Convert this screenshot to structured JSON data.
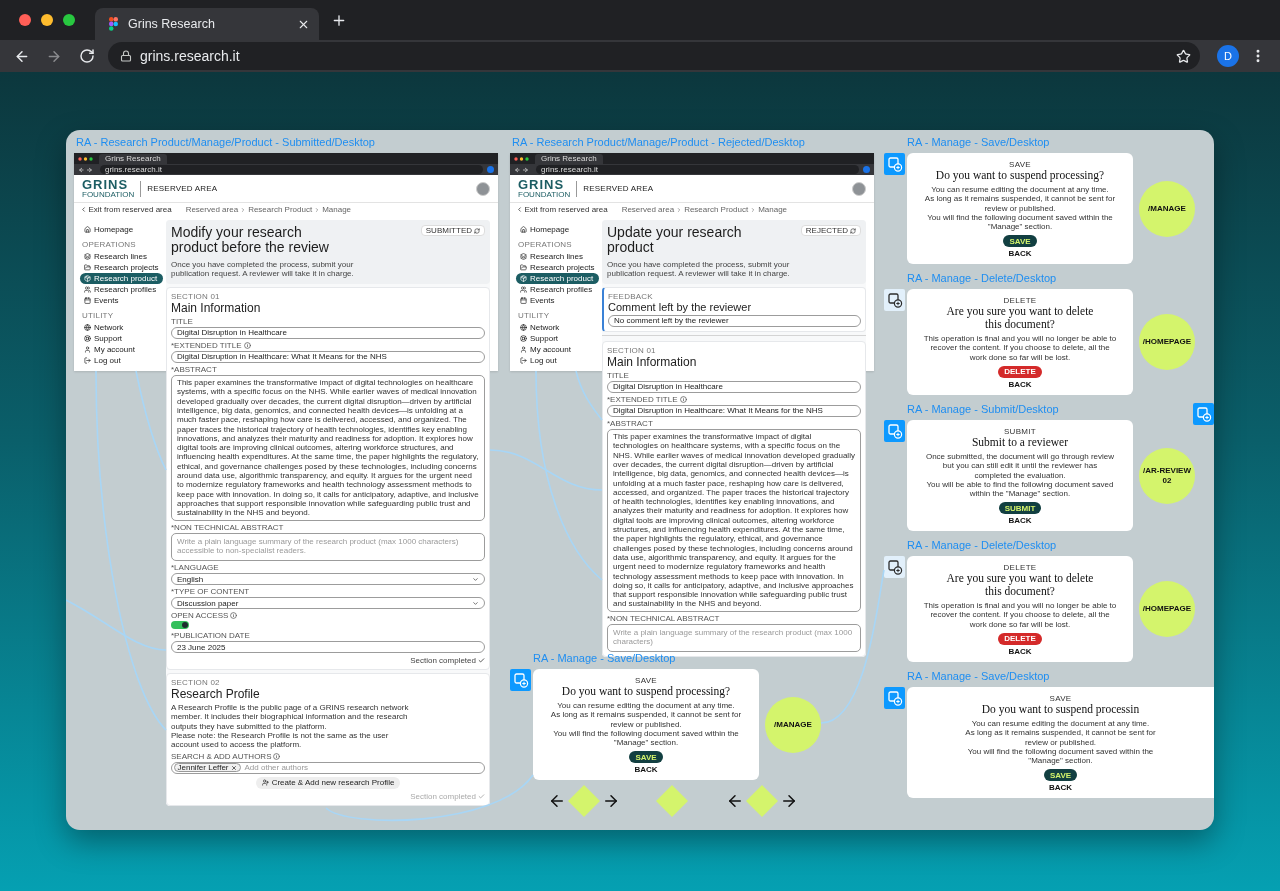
{
  "browser": {
    "tab_title": "Grins Research",
    "url": "grins.research.it",
    "avatar": "D"
  },
  "canvas": {
    "dialogs": [
      {
        "frame_label": "RA - Manage - Save/Desktop",
        "kind": "save",
        "flow_icon_active": true,
        "eyebrow": "SAVE",
        "heading": "Do you want to suspend processing?",
        "body": "You can resume editing the document at any time.\nAs long as it remains suspended, it cannot be sent for\nreview or published.\nYou will find the following document saved within the\n\"Manage\" section.",
        "button": "SAVE",
        "back": "BACK",
        "route": "/MANAGE"
      },
      {
        "frame_label": "RA - Manage - Delete/Desktop",
        "kind": "delete",
        "flow_icon_active": false,
        "eyebrow": "DELETE",
        "heading": "Are you sure you want to delete\nthis document?",
        "body": "This operation is final and you will no longer be able to\nrecover the content. If you choose to delete, all the\nwork done so far will be lost.",
        "button": "DELETE",
        "back": "BACK",
        "route": "/HOMEPAGE"
      },
      {
        "frame_label": "RA - Manage - Submit/Desktop",
        "kind": "submit",
        "flow_icon_active": true,
        "eyebrow": "SUBMIT",
        "heading": "Submit to a reviewer",
        "body": "Once submitted, the document will go through review\nbut you can still edit it until the reviewer has\ncompleted the evaluation.\nYou will be able to find the following document saved\nwithin the \"Manage\" section.",
        "button": "SUBMIT",
        "back": "BACK",
        "route": "/AR-REVIEW 02"
      },
      {
        "frame_label": "RA - Manage - Save/Desktop",
        "kind": "save",
        "flow_icon_active": true,
        "eyebrow": "SAVE",
        "heading": "Do you want to suspend processing?",
        "body": "You can resume editing the document at any time.\nAs long as it remains suspended, it cannot be sent for\nreview or published.\nYou will find the following document saved within the\n\"Manage\" section.",
        "button": "SAVE",
        "back": "BACK",
        "route": "/MANAGE"
      },
      {
        "frame_label": "RA - Manage - Delete/Desktop",
        "kind": "delete",
        "flow_icon_active": false,
        "eyebrow": "DELETE",
        "heading": "Are you sure you want to delete\nthis document?",
        "body": "This operation is final and you will no longer be able to\nrecover the content. If you choose to delete, all the\nwork done so far will be lost.",
        "button": "DELETE",
        "back": "BACK",
        "route": "/HOMEPAGE"
      },
      {
        "frame_label": "RA - Manage - Save/Desktop",
        "kind": "save",
        "flow_icon_active": true,
        "eyebrow": "SAVE",
        "heading": "Do you want to suspend processin",
        "body": "You can resume editing the document at any time.\nAs long as it remains suspended, it cannot be sent for\nreview or published.\nYou will find the following document saved within the\n\"Manage\" section.",
        "button": "SAVE",
        "back": "BACK"
      }
    ],
    "pages": [
      {
        "frame_label": "RA - Research Product/Manage/Product - Submitted/Desktop",
        "browser_tab": "Grins Research",
        "browser_url": "grins.research.it",
        "logo": "GRINS",
        "logo_tagline": "FOUNDATION",
        "area": "RESERVED AREA",
        "exit_link": "Exit from reserved area",
        "breadcrumb": [
          "Reserved area",
          "Research Product",
          "Manage"
        ],
        "sidebar": {
          "home": {
            "label": "Homepage",
            "selected": false
          },
          "groups": [
            {
              "title": "OPERATIONS",
              "items": [
                {
                  "label": "Research lines",
                  "selected": false
                },
                {
                  "label": "Research projects",
                  "selected": false
                },
                {
                  "label": "Research product",
                  "selected": true
                },
                {
                  "label": "Research profiles",
                  "selected": false
                },
                {
                  "label": "Events",
                  "selected": false
                }
              ]
            },
            {
              "title": "UTILITY",
              "items": [
                {
                  "label": "Network",
                  "selected": false
                },
                {
                  "label": "Support",
                  "selected": false
                },
                {
                  "label": "My account",
                  "selected": false
                },
                {
                  "label": "Log out",
                  "selected": false
                }
              ]
            }
          ]
        },
        "status": "SUBMITTED",
        "heading": "Modify your research\nproduct before the review",
        "intro": "Once you have completed the process, submit your\npublication request. A reviewer will take it in charge.",
        "sections": [
          {
            "kind": "form",
            "eyebrow": "SECTION 01",
            "title": "Main Information",
            "fields": [
              {
                "kind": "text",
                "label": "TITLE",
                "info": false,
                "value": "Digital Disruption in Healthcare"
              },
              {
                "kind": "text",
                "label": "*EXTENDED TITLE",
                "info": true,
                "value": "Digital Disruption in Healthcare: What It Means for the NHS"
              },
              {
                "kind": "textarea",
                "label": "*ABSTRACT",
                "info": false,
                "value": "This paper examines the transformative impact of digital technologies on healthcare systems, with a specific focus on the NHS. While earlier waves of medical innovation developed gradually over decades, the current digital disruption—driven by artificial intelligence, big data, genomics, and connected health devices—is unfolding at a much faster pace, reshaping how care is delivered, accessed, and organized. The paper traces the historical trajectory of health technologies, identifies key enabling innovations, and analyzes their maturity and readiness for adoption. It explores how digital tools are improving clinical outcomes, altering workforce structures, and influencing health expenditures. At the same time, the paper highlights the regulatory, ethical, and governance challenges posed by these technologies, including concerns around data use, algorithmic transparency, and equity. It argues for the urgent need to modernize regulatory frameworks and health technology assessment methods to keep pace with innovation. In doing so, it calls for anticipatory, adaptive, and inclusive approaches that support responsible innovation while safeguarding public trust and sustainability in the NHS and beyond."
              },
              {
                "kind": "textarea",
                "label": "*NON TECHNICAL ABSTRACT",
                "info": false,
                "placeholder": "Write a plain language summary of the research product (max 1000 characters)\naccessible to non-specialist readers."
              },
              {
                "kind": "select",
                "label": "*LANGUAGE",
                "info": false,
                "value": "English"
              },
              {
                "kind": "select",
                "label": "*TYPE OF CONTENT",
                "info": false,
                "value": "Discussion paper"
              },
              {
                "kind": "toggle",
                "label": "OPEN ACCESS",
                "info": true,
                "on": true
              },
              {
                "kind": "text",
                "label": "*PUBLICATION DATE",
                "info": false,
                "value": "23 June 2025"
              }
            ],
            "completion": {
              "label": "Section completed",
              "done": true
            }
          },
          {
            "kind": "form",
            "eyebrow": "SECTION 02",
            "title": "Research Profile",
            "description": "A Research Profile is the public page of a GRINS research network\nmember. It includes their biographical information and the research\noutputs they have submitted to the platform.\nPlease note: the Research Profile is not the same as the user\naccount used to access the platform.",
            "fields": [
              {
                "kind": "chips",
                "label": "SEARCH & ADD AUTHORS",
                "info": true,
                "chips": [
                  "Jennifer Leffer"
                ],
                "placeholder": "Add other authors"
              }
            ],
            "action": "Create & Add new research Profile",
            "completion": {
              "label": "Section completed",
              "done": false
            }
          }
        ]
      },
      {
        "frame_label": "RA - Research Product/Manage/Product - Rejected/Desktop",
        "browser_tab": "Grins Research",
        "browser_url": "grins.research.it",
        "logo": "GRINS",
        "logo_tagline": "FOUNDATION",
        "area": "RESERVED AREA",
        "exit_link": "Exit from reserved area",
        "breadcrumb": [
          "Reserved area",
          "Research Product",
          "Manage"
        ],
        "sidebar": {
          "home": {
            "label": "Homepage",
            "selected": false
          },
          "groups": [
            {
              "title": "OPERATIONS",
              "items": [
                {
                  "label": "Research lines",
                  "selected": false
                },
                {
                  "label": "Research projects",
                  "selected": false
                },
                {
                  "label": "Research product",
                  "selected": true
                },
                {
                  "label": "Research profiles",
                  "selected": false
                },
                {
                  "label": "Events",
                  "selected": false
                }
              ]
            },
            {
              "title": "UTILITY",
              "items": [
                {
                  "label": "Network",
                  "selected": false
                },
                {
                  "label": "Support",
                  "selected": false
                },
                {
                  "label": "My account",
                  "selected": false
                },
                {
                  "label": "Log out",
                  "selected": false
                }
              ]
            }
          ]
        },
        "status": "REJECTED",
        "heading": "Update your research\nproduct",
        "intro": "Once you have completed the process, submit your\npublication request. A reviewer will take it in charge.",
        "sections": [
          {
            "kind": "feedback",
            "eyebrow": "FEEDBACK",
            "title": "Comment left by the reviewer",
            "comment": "No comment left by the reviewer"
          },
          {
            "kind": "form",
            "eyebrow": "SECTION 01",
            "title": "Main Information",
            "fields": [
              {
                "kind": "text",
                "label": "TITLE",
                "info": false,
                "value": "Digital Disruption in Healthcare"
              },
              {
                "kind": "text",
                "label": "*EXTENDED TITLE",
                "info": true,
                "value": "Digital Disruption in Healthcare: What It Means for the NHS"
              },
              {
                "kind": "textarea",
                "label": "*ABSTRACT",
                "info": false,
                "value": "This paper examines the transformative impact of digital technologies on healthcare systems, with a specific focus on the NHS. While earlier waves of medical innovation developed gradually over decades, the current digital disruption—driven by artificial intelligence, big data, genomics, and connected health devices—is unfolding at a much faster pace, reshaping how care is delivered, accessed, and organized. The paper traces the historical trajectory of health technologies, identifies key enabling innovations, and analyzes their maturity and readiness for adoption. It explores how digital tools are improving clinical outcomes, altering workforce structures, and influencing health expenditures. At the same time, the paper highlights the regulatory, ethical, and governance challenges posed by these technologies, including concerns around data use, algorithmic transparency, and equity. It argues for the urgent need to modernize regulatory frameworks and health technology assessment methods to keep pace with innovation. In doing so, it calls for anticipatory, adaptive, and inclusive approaches that support responsible innovation while safeguarding public trust and sustainability in the NHS and beyond."
              },
              {
                "kind": "textarea",
                "label": "*NON TECHNICAL ABSTRACT",
                "info": false,
                "placeholder": "Write a plain language summary of the research product (max 1000 characters)"
              }
            ]
          }
        ]
      }
    ],
    "offscreen_flow_icon": {
      "active": true
    }
  }
}
